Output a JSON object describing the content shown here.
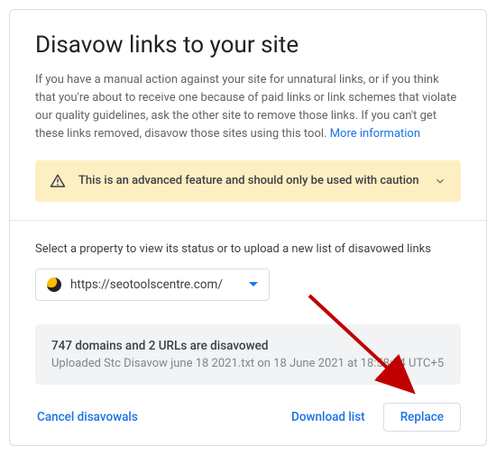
{
  "header": {
    "title": "Disavow links to your site",
    "description_pre": "If you have a manual action against your site for unnatural links, or if you think that you're about to receive one because of paid links or link schemes that violate our quality guidelines, ask the other site to remove those links. If you can't get these links removed, disavow those sites using this tool. ",
    "more_info": "More information"
  },
  "warning": {
    "text": "This is an advanced feature and should only be used with caution"
  },
  "property": {
    "prompt": "Select a property to view its status or to upload a new list of disavowed links",
    "selected": "https://seotoolscentre.com/"
  },
  "status": {
    "summary": "747 domains and 2 URLs are disavowed",
    "uploaded": "Uploaded Stc Disavow june 18 2021.txt on 18 June 2021 at 18:58:14 UTC+5"
  },
  "actions": {
    "cancel": "Cancel disavowals",
    "download": "Download list",
    "replace": "Replace"
  }
}
